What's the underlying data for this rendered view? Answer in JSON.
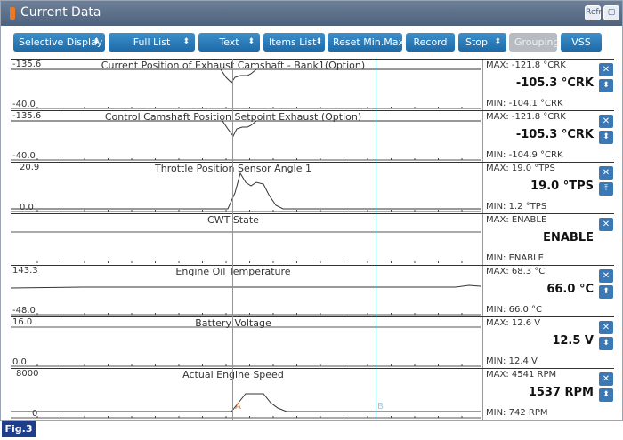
{
  "window": {
    "title": "Current Data",
    "refresh_icon": "refresh-icon",
    "restore_icon": "window-restore-icon",
    "refresh_label": "Refre"
  },
  "toolbar": {
    "buttons": [
      {
        "label": "Selective Display",
        "has_caret": true
      },
      {
        "label": "Full List",
        "has_caret": true
      },
      {
        "label": "Text",
        "has_caret": true
      },
      {
        "label": "Items List",
        "has_caret": true
      },
      {
        "label": "Reset Min.Max",
        "has_caret": false
      },
      {
        "label": "Record",
        "has_caret": false
      },
      {
        "label": "Stop",
        "has_caret": true
      },
      {
        "label": "Grouping",
        "has_caret": false,
        "disabled": true
      },
      {
        "label": "VSS",
        "has_caret": false
      }
    ]
  },
  "colors": {
    "accent": "#1d6aa8",
    "cursor_a": "#e08040",
    "cursor_b": "#7fd8e8",
    "figure_tag": "#1c3e8c"
  },
  "cursors": {
    "a_label": "A",
    "b_label": "B"
  },
  "parameters": [
    {
      "title": "Current Position of Exhaust Camshaft - Bank1(Option)",
      "scale_max": "-135.6",
      "scale_min": "-40.0",
      "max": "MAX: -121.8 °CRK",
      "min": "MIN: -104.1 °CRK",
      "current": "-105.3 °CRK"
    },
    {
      "title": "Control Camshaft Position Setpoint Exhaust (Option)",
      "scale_max": "-135.6",
      "scale_min": "-40.0",
      "max": "MAX: -121.8 °CRK",
      "min": "MIN: -104.9 °CRK",
      "current": "-105.3 °CRK"
    },
    {
      "title": "Throttle Position Sensor Angle 1",
      "scale_max": "20.9",
      "scale_min": "0.0",
      "max": "MAX: 19.0 °TPS",
      "min": "MIN: 1.2 °TPS",
      "current": "19.0 °TPS"
    },
    {
      "title": "CWT State",
      "scale_max": "",
      "scale_min": "",
      "max": "MAX: ENABLE",
      "min": "MIN: ENABLE",
      "current": "ENABLE"
    },
    {
      "title": "Engine Oil Temperature",
      "scale_max": "143.3",
      "scale_min": "-48.0",
      "max": "MAX: 68.3 °C",
      "min": "MIN: 66.0 °C",
      "current": "66.0 °C"
    },
    {
      "title": "Battery Voltage",
      "scale_max": "16.0",
      "scale_min": "0.0",
      "max": "MAX: 12.6 V",
      "min": "MIN: 12.4 V",
      "current": "12.5 V"
    },
    {
      "title": "Actual Engine Speed",
      "scale_max": "8000",
      "scale_min": "0",
      "max": "MAX: 4541 RPM",
      "min": "MIN: 742 RPM",
      "current": "1537 RPM"
    }
  ],
  "figure_label": "Fig.3"
}
